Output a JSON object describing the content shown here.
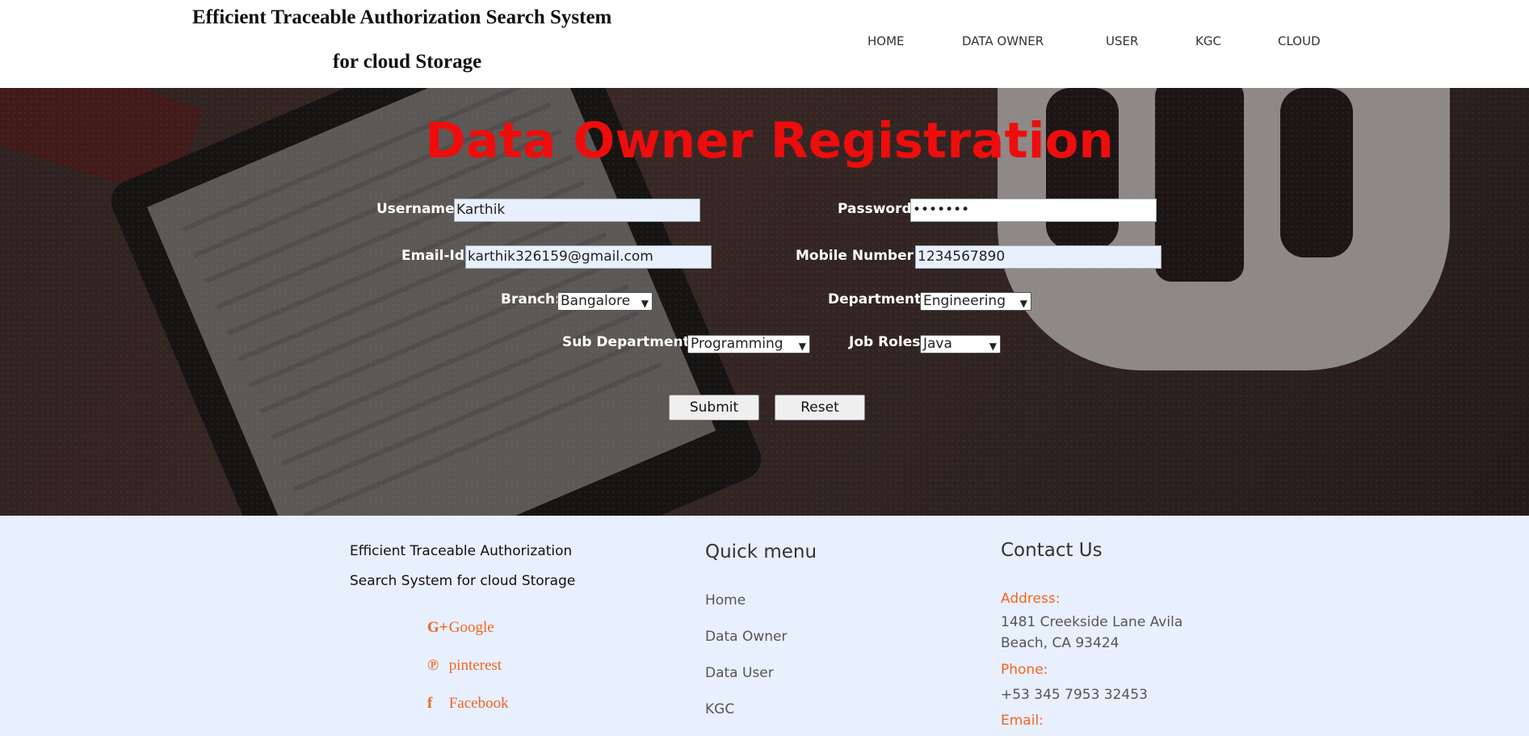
{
  "header": {
    "title_line1": "Efficient Traceable Authorization Search System",
    "title_line2": "for cloud Storage",
    "nav": [
      "HOME",
      "DATA OWNER",
      "USER",
      "KGC",
      "CLOUD"
    ]
  },
  "form": {
    "title": "Data Owner Registration",
    "username_label": "Username:",
    "username_value": "Karthik",
    "password_label": "Password:",
    "password_value": "•••••••",
    "email_label": "Email-Id:",
    "email_value": "karthik326159@gmail.com",
    "mobile_label": "Mobile Number :",
    "mobile_value": "1234567890",
    "branch_label": "Branch:",
    "branch_value": "Bangalore",
    "department_label": "Department:",
    "department_value": "Engineering",
    "subdept_label": "Sub Department:",
    "subdept_value": "Programming",
    "jobroles_label": "Job Roles:",
    "jobroles_value": "Java",
    "submit_label": "Submit",
    "reset_label": "Reset"
  },
  "footer": {
    "about_line1": "Efficient Traceable Authorization",
    "about_line2": "Search System for cloud Storage",
    "social": [
      {
        "icon": "google-plus-icon",
        "glyph": "G+",
        "label": "Google"
      },
      {
        "icon": "pinterest-icon",
        "glyph": "℗",
        "label": "pinterest"
      },
      {
        "icon": "facebook-icon",
        "glyph": "f",
        "label": "Facebook"
      }
    ],
    "quick_menu_title": "Quick menu",
    "quick_menu": [
      "Home",
      "Data Owner",
      "Data User",
      "KGC"
    ],
    "contact_title": "Contact Us",
    "address_label": "Address:",
    "address_line1": "1481 Creekside Lane Avila",
    "address_line2": "Beach, CA 93424",
    "phone_label": "Phone:",
    "phone_value": "+53 345 7953 32453",
    "email_label": "Email:"
  },
  "colors": {
    "accent_red": "#ee0d0d",
    "accent_orange": "#f26522",
    "footer_bg": "#e8effd"
  }
}
